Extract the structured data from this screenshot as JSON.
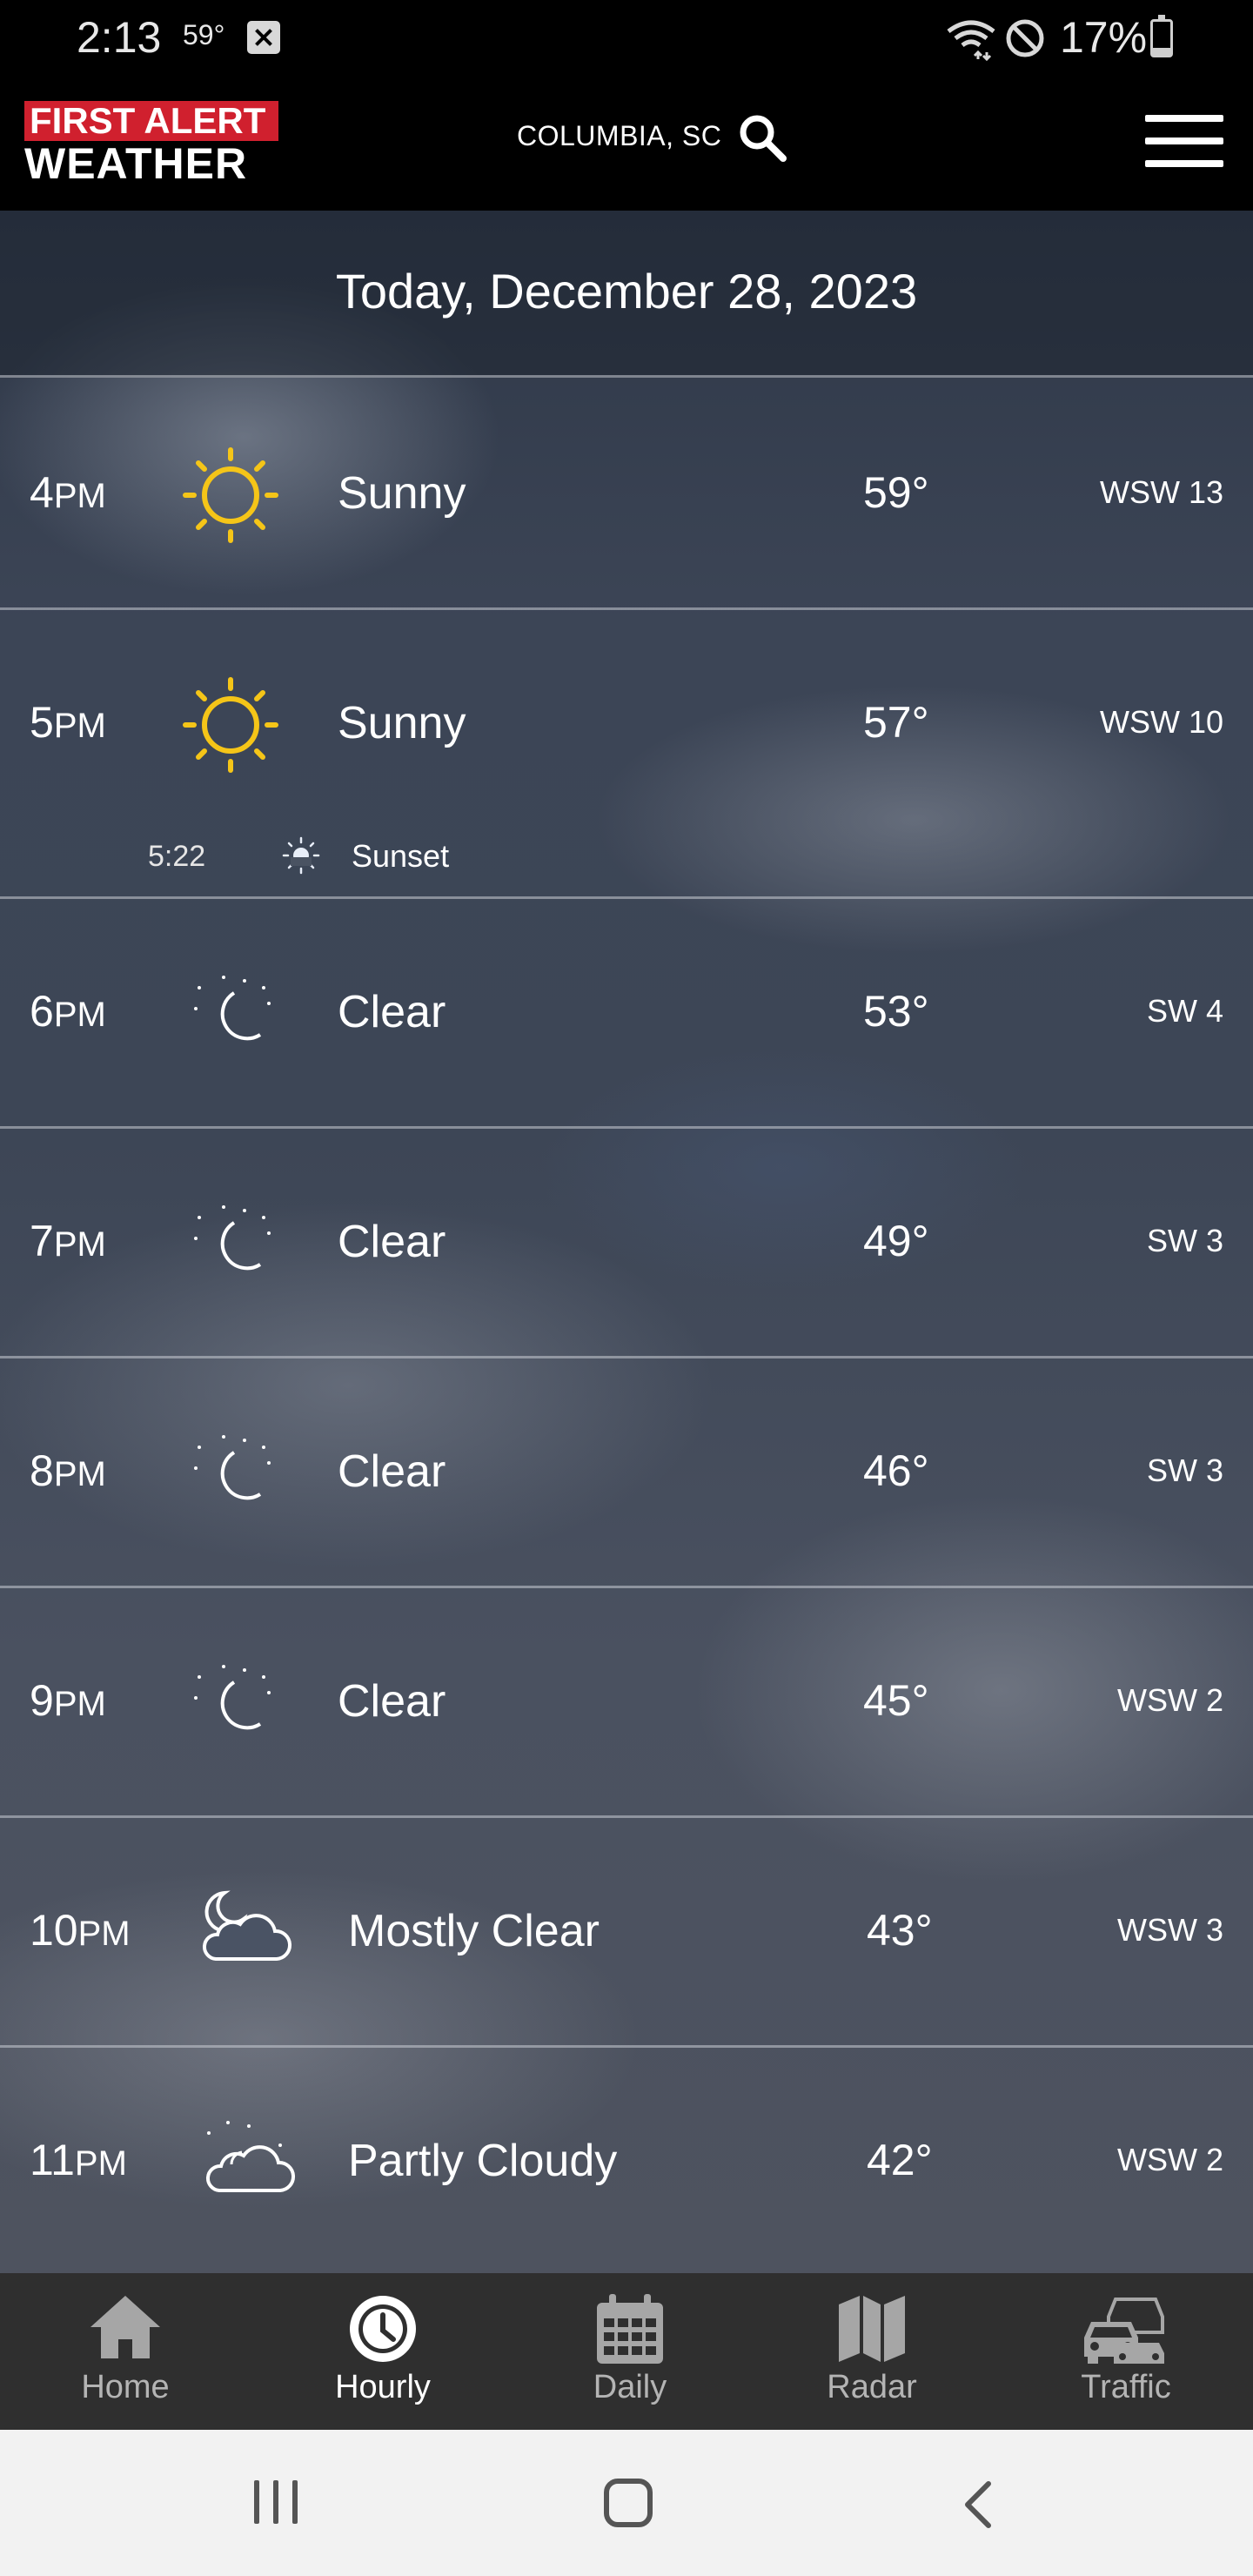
{
  "status_bar": {
    "time": "2:13",
    "temp": "59°",
    "battery": "17%"
  },
  "header": {
    "logo_top": "FIRST ALERT",
    "logo_bottom": "WEATHER",
    "location": "COLUMBIA, SC"
  },
  "date_header": "Today, December 28, 2023",
  "hours": [
    {
      "hour": "4",
      "ampm": "PM",
      "icon": "sun-icon",
      "condition": "Sunny",
      "temp": "59°",
      "wind": "WSW 13"
    },
    {
      "hour": "5",
      "ampm": "PM",
      "icon": "sun-icon",
      "condition": "Sunny",
      "temp": "57°",
      "wind": "WSW 10"
    },
    {
      "hour": "6",
      "ampm": "PM",
      "icon": "moon-icon",
      "condition": "Clear",
      "temp": "53°",
      "wind": "SW 4"
    },
    {
      "hour": "7",
      "ampm": "PM",
      "icon": "moon-icon",
      "condition": "Clear",
      "temp": "49°",
      "wind": "SW 3"
    },
    {
      "hour": "8",
      "ampm": "PM",
      "icon": "moon-icon",
      "condition": "Clear",
      "temp": "46°",
      "wind": "SW 3"
    },
    {
      "hour": "9",
      "ampm": "PM",
      "icon": "moon-icon",
      "condition": "Clear",
      "temp": "45°",
      "wind": "WSW 2"
    },
    {
      "hour": "10",
      "ampm": "PM",
      "icon": "moon-cloud-icon",
      "condition": "Mostly Clear",
      "temp": "43°",
      "wind": "WSW 3"
    },
    {
      "hour": "11",
      "ampm": "PM",
      "icon": "partly-cloudy-night-icon",
      "condition": "Partly Cloudy",
      "temp": "42°",
      "wind": "WSW 2"
    }
  ],
  "sunset": {
    "time": "5:22",
    "label": "Sunset",
    "icon": "sunset-icon"
  },
  "bottom_nav": [
    {
      "label": "Home",
      "icon": "home-icon"
    },
    {
      "label": "Hourly",
      "icon": "clock-icon",
      "active": true
    },
    {
      "label": "Daily",
      "icon": "calendar-icon"
    },
    {
      "label": "Radar",
      "icon": "map-icon"
    },
    {
      "label": "Traffic",
      "icon": "traffic-icon"
    }
  ],
  "colors": {
    "brand_red": "#d0202e",
    "sun_yellow": "#f5c518",
    "nav_background": "#2f2f2f",
    "header_background": "#000000"
  }
}
